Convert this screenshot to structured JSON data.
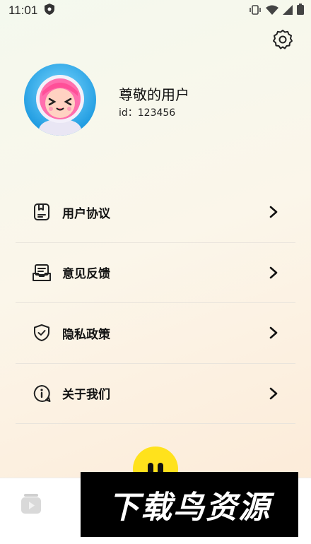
{
  "status_bar": {
    "time": "11:01",
    "icons": [
      "shield-icon",
      "vibrate-icon",
      "wifi-icon",
      "signal-icon",
      "battery-icon"
    ]
  },
  "header": {
    "settings_icon": "gear-icon"
  },
  "profile": {
    "name": "尊敬的用户",
    "id_text": "id：123456"
  },
  "menu": {
    "items": [
      {
        "label": "用户协议",
        "icon": "document-icon"
      },
      {
        "label": "意见反馈",
        "icon": "feedback-tray-icon"
      },
      {
        "label": "隐私政策",
        "icon": "shield-check-icon"
      },
      {
        "label": "关于我们",
        "icon": "info-icon"
      }
    ]
  },
  "tab_bar": {
    "home_icon": "video-play-icon",
    "center_icon": "pause-face-icon"
  },
  "watermark": {
    "text": "下载鸟资源"
  },
  "colors": {
    "accent_yellow": "#ffe21c",
    "avatar_blue": "#1d9ae0",
    "text": "#111111"
  }
}
